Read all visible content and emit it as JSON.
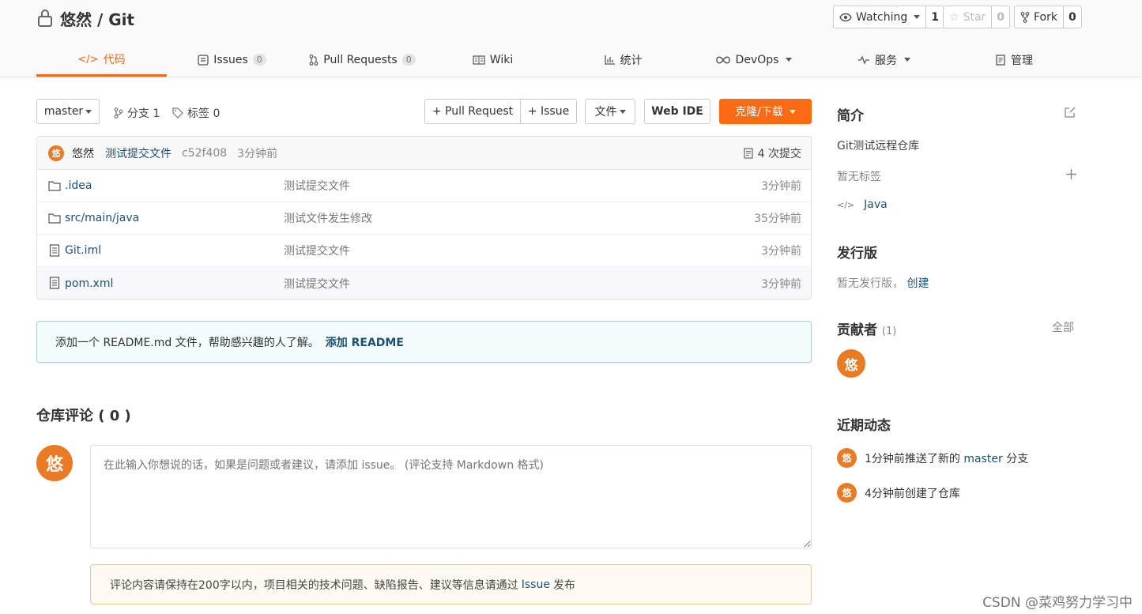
{
  "repo": {
    "owner_repo": "悠然 / Git"
  },
  "actions": {
    "watch": {
      "label": "Watching",
      "count": "1"
    },
    "star": {
      "label": "Star",
      "count": "0"
    },
    "fork": {
      "label": "Fork",
      "count": "0"
    }
  },
  "tabs": [
    {
      "label": "代码",
      "active": true
    },
    {
      "label": "Issues",
      "badge": "0"
    },
    {
      "label": "Pull Requests",
      "badge": "0"
    },
    {
      "label": "Wiki"
    },
    {
      "label": "统计"
    },
    {
      "label": "DevOps"
    },
    {
      "label": "服务"
    },
    {
      "label": "管理"
    }
  ],
  "toolbar": {
    "branch": "master",
    "branches": "分支 1",
    "tags": "标签 0",
    "pull_request": "+ Pull Request",
    "issue": "+ Issue",
    "file": "文件",
    "web_ide": "Web IDE",
    "clone": "克隆/下载"
  },
  "commit": {
    "avatar": "悠",
    "author": "悠然",
    "message": "测试提交文件",
    "hash": "c52f408",
    "time": "3分钟前",
    "count": "4 次提交"
  },
  "files": [
    {
      "name": ".idea",
      "type": "folder",
      "message": "测试提交文件",
      "time": "3分钟前"
    },
    {
      "name": "src/main/java",
      "type": "folder",
      "message": "测试文件发生修改",
      "time": "35分钟前"
    },
    {
      "name": "Git.iml",
      "type": "file",
      "message": "测试提交文件",
      "time": "3分钟前"
    },
    {
      "name": "pom.xml",
      "type": "file",
      "message": "测试提交文件",
      "time": "3分钟前"
    }
  ],
  "readme": {
    "text": "添加一个 README.md 文件，帮助感兴趣的人了解。",
    "link": "添加 README"
  },
  "comments": {
    "title": "仓库评论 ( 0 )",
    "avatar": "悠",
    "placeholder": "在此输入你想说的话，如果是问题或者建议，请添加 issue。 (评论支持 Markdown 格式)",
    "notice_pre": "评论内容请保持在200字以内，项目相关的技术问题、缺陷报告、建议等信息请通过",
    "notice_link": "Issue",
    "notice_post": "发布"
  },
  "sidebar": {
    "intro_title": "简介",
    "intro_desc": "Git测试远程仓库",
    "no_tags": "暂无标签",
    "language": "Java",
    "release_title": "发行版",
    "no_release": "暂无发行版，",
    "create": "创建",
    "contributors_title": "贡献者",
    "contributors_count": "(1)",
    "contributors_all": "全部",
    "contributor_avatar": "悠",
    "activity_title": "近期动态",
    "activity": [
      {
        "avatar": "悠",
        "pre": "1分钟前推送了新的",
        "link": "master",
        "post": "分支"
      },
      {
        "avatar": "悠",
        "pre": "4分钟前创建了仓库",
        "link": "",
        "post": ""
      }
    ]
  },
  "watermark": "CSDN @菜鸡努力学习中"
}
